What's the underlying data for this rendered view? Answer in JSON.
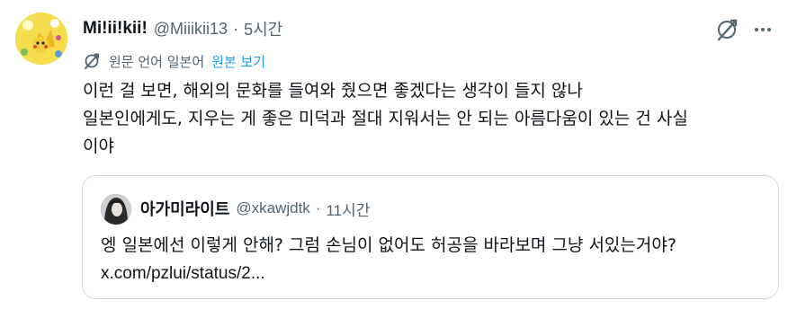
{
  "tweet": {
    "display_name": "Mi!ii!kii!",
    "handle": "@Miiikii13",
    "separator": "·",
    "time": "5시간",
    "translate": {
      "label": "원문 언어 일본어",
      "link": "원본 보기"
    },
    "text_lines": [
      "이런 걸 보면, 해외의 문화를 들여와 줬으면 좋겠다는 생각이 들지 않나",
      "일본인에게도, 지우는 게 좋은 미덕과 절대 지워서는 안 되는 아름다움이 있는 건 사실",
      "이야"
    ]
  },
  "quote": {
    "display_name": "아가미라이트",
    "handle": "@xkawjdtk",
    "separator": "·",
    "time": "11시간",
    "text_lines": [
      "엥 일본에선 이렇게 안해? 그럼 손님이 없어도 허공을 바라보며 그냥 서있는거야?",
      "x.com/pzlui/status/2..."
    ]
  },
  "icons": {
    "grok": "grok-icon",
    "more": "more-icon",
    "translate": "translate-icon"
  },
  "colors": {
    "text": "#0f1419",
    "secondary": "#536471",
    "link": "#1d9bf0",
    "border": "#cfd9de"
  }
}
